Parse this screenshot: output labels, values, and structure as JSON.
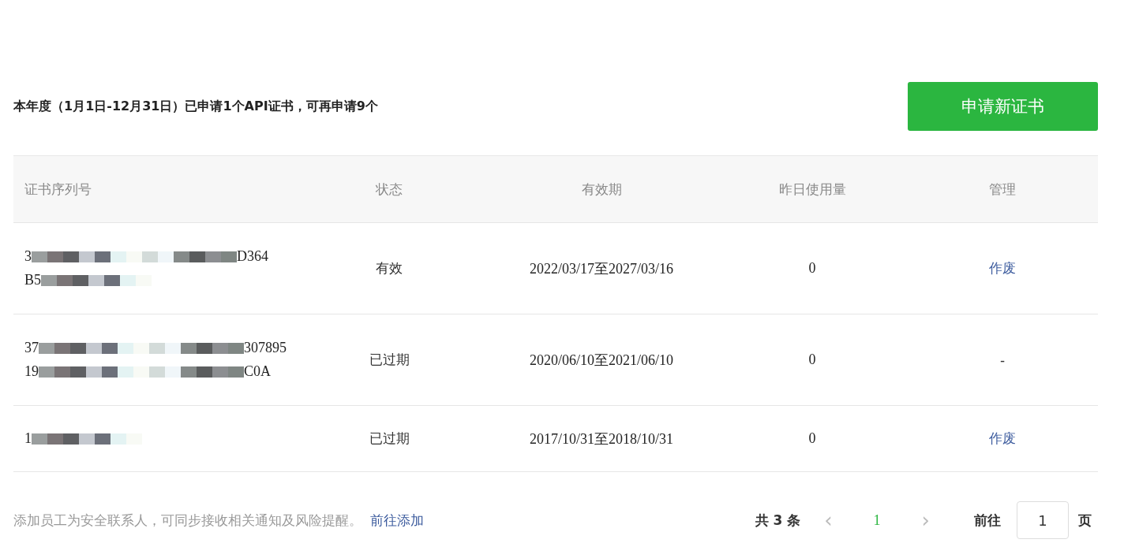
{
  "summary": "本年度（1月1日-12月31日）已申请1个API证书，可再申请9个",
  "apply_button": "申请新证书",
  "table": {
    "columns": [
      "证书序列号",
      "状态",
      "有效期",
      "昨日使用量",
      "管理"
    ],
    "rows": [
      {
        "serial": [
          {
            "start": "3",
            "end": "D364"
          },
          {
            "start": "B5"
          }
        ],
        "status": "有效",
        "validity": "2022/03/17至2027/03/16",
        "usage": "0",
        "action": {
          "kind": "link",
          "text": "作废"
        }
      },
      {
        "serial": [
          {
            "start": "37",
            "end": "307895"
          },
          {
            "start": "19",
            "end": "C0A"
          }
        ],
        "status": "已过期",
        "validity": "2020/06/10至2021/06/10",
        "usage": "0",
        "action": {
          "kind": "plain",
          "text": "-"
        }
      },
      {
        "serial": [
          {
            "start": "1"
          }
        ],
        "status": "已过期",
        "validity": "2017/10/31至2018/10/31",
        "usage": "0",
        "action": {
          "kind": "link",
          "text": "作废"
        }
      }
    ]
  },
  "footer": {
    "note": "添加员工为安全联系人，可同步接收相关通知及风险提醒。",
    "link": "前往添加"
  },
  "pagination": {
    "total": "共 3 条",
    "prev": "‹",
    "pages": [
      {
        "label": "1",
        "selected": true
      }
    ],
    "next": "›",
    "goto_label": "前往",
    "goto_value": "1",
    "goto_suffix": "页"
  }
}
